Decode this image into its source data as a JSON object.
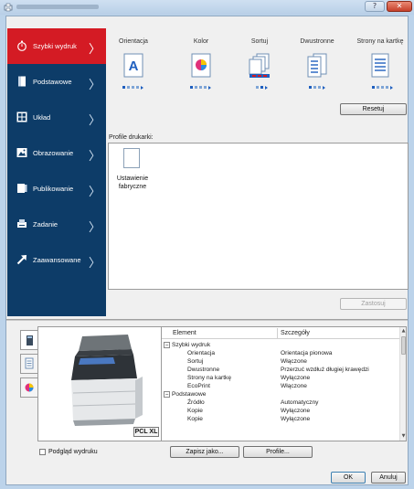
{
  "window": {
    "help_glyph": "?",
    "close_glyph": "✕"
  },
  "nav": {
    "items": [
      {
        "label": "Szybki wydruk",
        "icon": "stopwatch-icon",
        "active": true
      },
      {
        "label": "Podstawowe",
        "icon": "page-icon",
        "active": false
      },
      {
        "label": "Układ",
        "icon": "layout-icon",
        "active": false
      },
      {
        "label": "Obrazowanie",
        "icon": "image-icon",
        "active": false
      },
      {
        "label": "Publikowanie",
        "icon": "publishing-icon",
        "active": false
      },
      {
        "label": "Zadanie",
        "icon": "job-icon",
        "active": false
      },
      {
        "label": "Zaawansowane",
        "icon": "advanced-arrow-icon",
        "active": false
      }
    ],
    "chevron": "〉"
  },
  "quick_print": {
    "columns": [
      {
        "label": "Orientacja",
        "icon": "orientation-icon",
        "glyph": "A",
        "dots": 4,
        "active_dot": 1
      },
      {
        "label": "Kolor",
        "icon": "color-icon",
        "dots": 4,
        "active_dot": 1
      },
      {
        "label": "Sortuj",
        "icon": "collate-icon",
        "dots": 2,
        "active_dot": 2
      },
      {
        "label": "Dwustronne",
        "icon": "duplex-icon",
        "dots": 3,
        "active_dot": 1
      },
      {
        "label": "Strony na kartkę",
        "icon": "pages-per-sheet-icon",
        "dots": 4,
        "active_dot": 1
      }
    ],
    "reset_label": "Resetuj"
  },
  "profiles": {
    "label": "Profile drukarki:",
    "items": [
      {
        "label_line1": "Ustawienie",
        "label_line2": "fabryczne"
      }
    ],
    "apply_label": "Zastosuj"
  },
  "preview": {
    "badge": "PCL XL"
  },
  "details": {
    "headers": {
      "element": "Element",
      "details": "Szczegóły"
    },
    "rows": [
      {
        "kind": "group",
        "toggle": "−",
        "name": "Szybki wydruk",
        "value": ""
      },
      {
        "kind": "item",
        "name": "Orientacja",
        "value": "Orientacja pionowa"
      },
      {
        "kind": "item",
        "name": "Sortuj",
        "value": "Włączone"
      },
      {
        "kind": "item",
        "name": "Dwustronne",
        "value": "Przerzuć wzdłuż długiej krawędzi"
      },
      {
        "kind": "item",
        "name": "Strony na kartkę",
        "value": "Wyłączone"
      },
      {
        "kind": "item",
        "name": "EcoPrint",
        "value": "Włączone"
      },
      {
        "kind": "group",
        "toggle": "−",
        "name": "Podstawowe",
        "value": ""
      },
      {
        "kind": "item",
        "name": "Źródło",
        "value": "Automatyczny"
      },
      {
        "kind": "item",
        "name": "Kopie",
        "value": "Wyłączone"
      },
      {
        "kind": "item",
        "name": "Kopie",
        "value": "Wyłączone"
      }
    ]
  },
  "footer": {
    "preview_checkbox_label": "Podgląd wydruku",
    "preview_checked": false,
    "save_as_label": "Zapisz jako...",
    "profile_label": "Profile...",
    "ok_label": "OK",
    "cancel_label": "Anuluj"
  },
  "colors": {
    "nav_bg": "#0d3c68",
    "nav_active": "#d41b24",
    "accent_blue": "#1f5fbf"
  }
}
